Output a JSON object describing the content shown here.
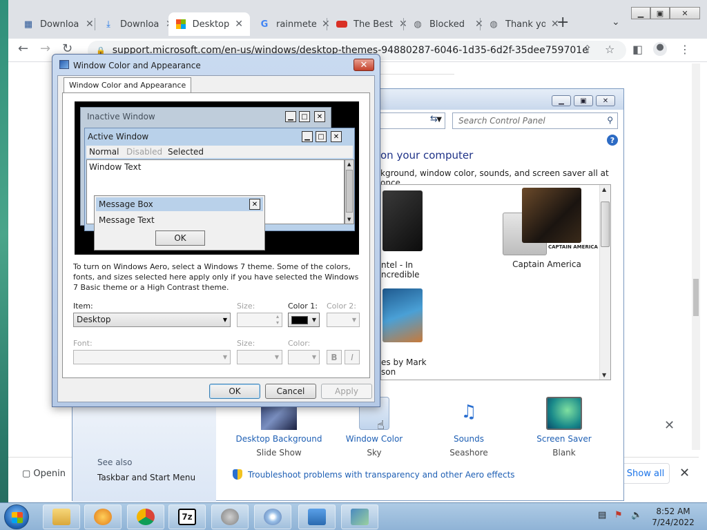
{
  "browser": {
    "tabs": [
      {
        "title": "Downloa",
        "icon": "document-icon"
      },
      {
        "title": "Downloa",
        "icon": "download-icon"
      },
      {
        "title": "Desktop",
        "icon": "windows-logo-icon",
        "active": true
      },
      {
        "title": "rainmete",
        "icon": "google-icon"
      },
      {
        "title": "The Best",
        "icon": "site-icon"
      },
      {
        "title": "Blocked",
        "icon": "globe-icon"
      },
      {
        "title": "Thank yo",
        "icon": "globe-icon"
      }
    ],
    "url": "support.microsoft.com/en-us/windows/desktop-themes-94880287-6046-1d35-6d2f-35dee759701e",
    "download_item": "Openin",
    "show_all": "Show all"
  },
  "control_panel": {
    "search_placeholder": "Search Control Panel",
    "heading": "on your computer",
    "subtext": "kground, window color, sounds, and screen saver all at once.",
    "themes": [
      {
        "label_line1": "ntel - In",
        "label_line2": "ncredible"
      },
      {
        "label_line1": "Captain America",
        "label_line2": ""
      },
      {
        "label_line1": "es by Mark",
        "label_line2": "son"
      }
    ],
    "captain_america_logo_text": "CAPTAIN AMERICA",
    "bottom_items": [
      {
        "name": "Desktop Background",
        "value": "Slide Show"
      },
      {
        "name": "Window Color",
        "value": "Sky"
      },
      {
        "name": "Sounds",
        "value": "Seashore"
      },
      {
        "name": "Screen Saver",
        "value": "Blank"
      }
    ],
    "see_also": "See also",
    "taskbar_link": "Taskbar and Start Menu",
    "troubleshoot_link": "Troubleshoot problems with transparency and other Aero effects"
  },
  "dialog": {
    "title": "Window Color and Appearance",
    "tab": "Window Color and Appearance",
    "preview": {
      "inactive_title": "Inactive Window",
      "active_title": "Active Window",
      "menu_normal": "Normal",
      "menu_disabled": "Disabled",
      "menu_selected": "Selected",
      "window_text": "Window Text",
      "message_box_title": "Message Box",
      "message_text": "Message Text",
      "ok": "OK"
    },
    "description": "To turn on Windows Aero, select a Windows 7 theme.  Some of the colors, fonts, and sizes selected here apply only if you have selected the Windows 7 Basic theme or a High Contrast theme.",
    "item_label": "Item:",
    "item_value": "Desktop",
    "size_label": "Size:",
    "color1_label": "Color 1:",
    "color2_label": "Color 2:",
    "font_label": "Font:",
    "font_size_label": "Size:",
    "font_color_label": "Color:",
    "bold": "B",
    "italic": "I",
    "ok_button": "OK",
    "cancel_button": "Cancel",
    "apply_button": "Apply",
    "color1_value": "#000000"
  },
  "taskbar": {
    "time": "8:52 AM",
    "date": "7/24/2022"
  },
  "colors": {
    "link": "#1e5fb4",
    "heading": "#1e3287",
    "active_title": "#b9d1ea",
    "inactive_title": "#bfcddb"
  }
}
